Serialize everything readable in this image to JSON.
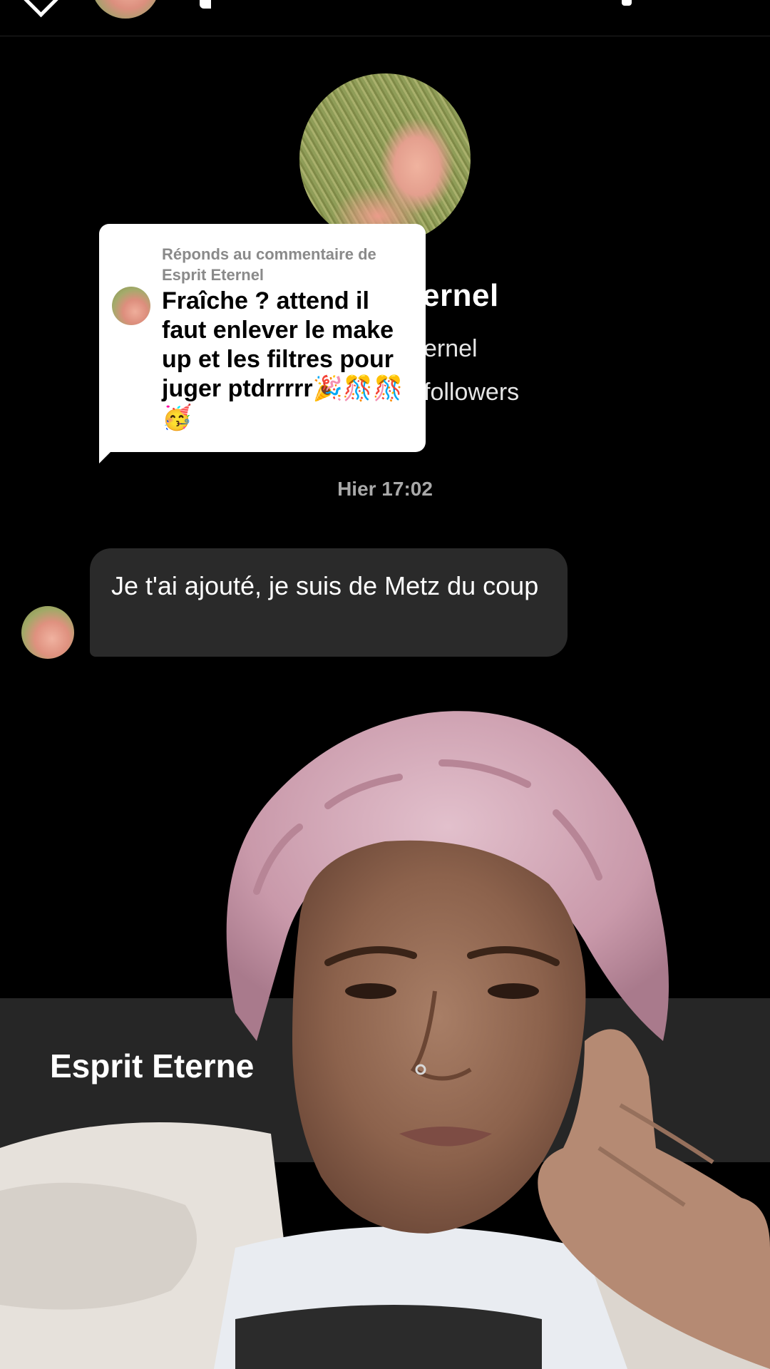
{
  "reply_card": {
    "caption": "Réponds au commentaire de Esprit Eternel",
    "text": "Fraîche ? attend il faut enlever le make up et les filtres pour juger ptdrrrrr🎉🎊🎊🥳"
  },
  "profile": {
    "name_fragment": "ernel",
    "handle_fragment": "ernel",
    "followers_fragment": "followers"
  },
  "timestamp": "Hier 17:02",
  "message": {
    "text": "Je t'ai ajouté, je suis de Metz du coup"
  },
  "bottom": {
    "name_fragment": "Esprit Eterne"
  },
  "icons": {
    "back": "chevron-left-icon"
  }
}
